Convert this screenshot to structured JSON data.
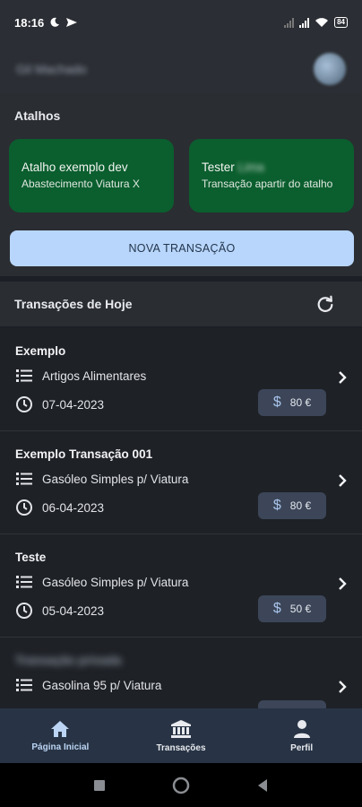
{
  "status": {
    "time": "18:16",
    "battery": "84"
  },
  "header": {
    "username": "Gil Machado"
  },
  "shortcuts": {
    "title": "Atalhos",
    "items": [
      {
        "title": "Atalho exemplo dev",
        "subtitle": "Abastecimento Viatura X"
      },
      {
        "title": "Tester",
        "title_hidden": "Lima",
        "subtitle": "Transação apartir do atalho"
      }
    ],
    "new_transaction_label": "NOVA TRANSAÇÃO"
  },
  "today": {
    "title": "Transações de Hoje"
  },
  "transactions": [
    {
      "name": "Exemplo",
      "category": "Artigos Alimentares",
      "date": "07-04-2023",
      "amount": "80 €",
      "currency_icon": "$"
    },
    {
      "name": "Exemplo Transação 001",
      "category": "Gasóleo Simples p/ Viatura",
      "date": "06-04-2023",
      "amount": "80 €",
      "currency_icon": "$"
    },
    {
      "name": "Teste",
      "category": "Gasóleo Simples p/ Viatura",
      "date": "05-04-2023",
      "amount": "50 €",
      "currency_icon": "$"
    },
    {
      "name": "Transação privada",
      "category": "Gasolina 95 p/ Viatura",
      "date": "",
      "amount": "",
      "currency_icon": "$"
    }
  ],
  "nav": {
    "items": [
      {
        "label": "Página Inicial",
        "icon": "home-icon",
        "active": true
      },
      {
        "label": "Transações",
        "icon": "bank-icon",
        "active": false
      },
      {
        "label": "Perfil",
        "icon": "person-icon",
        "active": false
      }
    ]
  },
  "colors": {
    "shortcut_bg": "#0b5e2e",
    "button_bg": "#b8d6fb",
    "nav_bg": "#283445",
    "amount_bg": "#3c4658"
  }
}
